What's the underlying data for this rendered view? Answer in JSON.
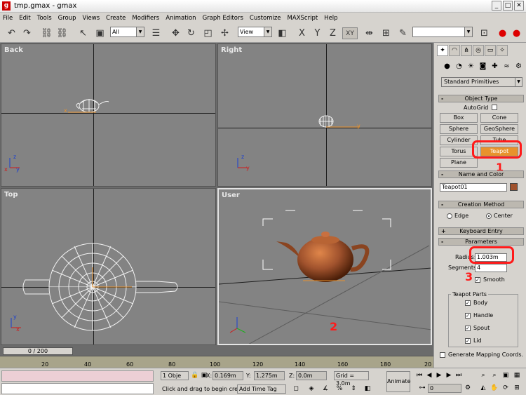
{
  "window": {
    "title": "tmp.gmax - gmax"
  },
  "menu": [
    "File",
    "Edit",
    "Tools",
    "Group",
    "Views",
    "Create",
    "Modifiers",
    "Animation",
    "Graph Editors",
    "Customize",
    "MAXScript",
    "Help"
  ],
  "toolbar": {
    "selection_filter": "All",
    "reference_coord": "View",
    "axis_constraints": [
      "X",
      "Y",
      "Z",
      "XY"
    ]
  },
  "viewports": {
    "back": "Back",
    "right": "Right",
    "top": "Top",
    "user": "User"
  },
  "axis_labels": {
    "x": "x",
    "y": "y",
    "z": "z"
  },
  "command_panel": {
    "category": "Standard Primitives",
    "object_type": {
      "header": "Object Type",
      "autogrid": "AutoGrid",
      "buttons": [
        "Box",
        "Cone",
        "Sphere",
        "GeoSphere",
        "Cylinder",
        "Tube",
        "Torus",
        "Teapot",
        "Plane"
      ],
      "active_button": "Teapot"
    },
    "name_and_color": {
      "header": "Name and Color",
      "name": "Teapot01",
      "color": "#a0522d"
    },
    "creation_method": {
      "header": "Creation Method",
      "options": [
        "Edge",
        "Center"
      ],
      "selected": "Center"
    },
    "keyboard_entry": {
      "header": "Keyboard Entry"
    },
    "parameters": {
      "header": "Parameters",
      "radius_label": "Radius:",
      "radius_value": "1.003m",
      "segments_label": "Segments:",
      "segments_value": "4",
      "smooth_label": "Smooth",
      "parts_header": "Teapot Parts",
      "parts": [
        "Body",
        "Handle",
        "Spout",
        "Lid"
      ],
      "mapping": "Generate Mapping Coords."
    }
  },
  "annotations": [
    "1",
    "2",
    "3"
  ],
  "timeline": {
    "slider": "0 / 200",
    "ticks": [
      "20",
      "40",
      "60",
      "80",
      "100",
      "120",
      "140",
      "160",
      "180",
      "20"
    ]
  },
  "status": {
    "selection": "1 Obje",
    "x_label": "X:",
    "x_value": "0.169m",
    "y_label": "Y:",
    "y_value": "1.275m",
    "z_label": "Z:",
    "z_value": "0.0m",
    "grid": "Grid = 3.0m",
    "prompt": "Click and drag to begin creati",
    "add_time_tag": "Add Time Tag",
    "animate": "Animate",
    "frame": "0"
  },
  "colors": {
    "teapot": "#a0522d",
    "active_button": "#e8922c",
    "annotation": "#ff1a1a",
    "viewport_bg": "#838383"
  }
}
